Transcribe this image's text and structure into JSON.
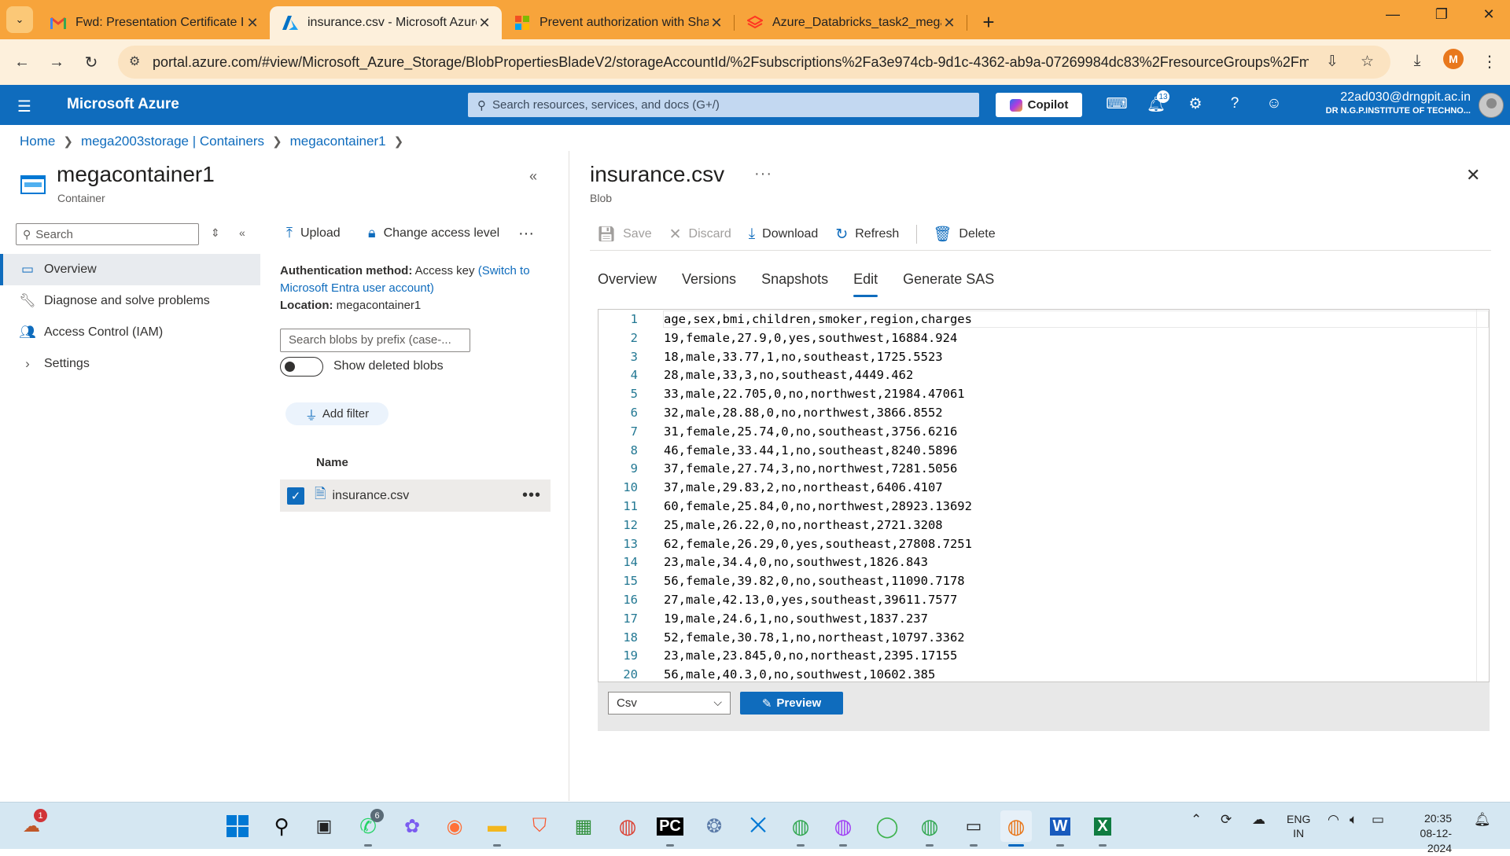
{
  "browser": {
    "tabs": [
      {
        "title": "Fwd: Presentation Certificate ID",
        "icon": "gmail-icon"
      },
      {
        "title": "insurance.csv - Microsoft Azure",
        "icon": "azure-icon",
        "active": true
      },
      {
        "title": "Prevent authorization with Shar",
        "icon": "microsoft-icon"
      },
      {
        "title": "Azure_Databricks_task2_mega -",
        "icon": "databricks-icon"
      }
    ],
    "url": "portal.azure.com/#view/Microsoft_Azure_Storage/BlobPropertiesBladeV2/storageAccountId/%2Fsubscriptions%2Fa3e974cb-9d1c-4362-ab9a-07269984dc83%2FresourceGroups%2Fmega_da...",
    "profile_initial": "M"
  },
  "azure": {
    "brand": "Microsoft Azure",
    "search_placeholder": "Search resources, services, and docs (G+/)",
    "copilot_label": "Copilot",
    "notifications_count": "13",
    "account_email": "22ad030@drngpit.ac.in",
    "account_org": "DR N.G.P.INSTITUTE OF TECHNO..."
  },
  "breadcrumb": [
    "Home",
    "mega2003storage | Containers",
    "megacontainer1"
  ],
  "container": {
    "title": "megacontainer1",
    "subtitle": "Container",
    "search_placeholder": "Search",
    "nav": [
      "Overview",
      "Diagnose and solve problems",
      "Access Control (IAM)",
      "Settings"
    ],
    "commands": {
      "upload": "Upload",
      "change_access": "Change access level"
    },
    "auth_label": "Authentication method:",
    "auth_value": "Access key",
    "auth_link": "(Switch to Microsoft Entra user account)",
    "location_label": "Location:",
    "location_value": "megacontainer1",
    "prefix_placeholder": "Search blobs by prefix (case-...",
    "show_deleted": "Show deleted blobs",
    "add_filter": "Add filter",
    "name_header": "Name",
    "blobs": [
      "insurance.csv"
    ]
  },
  "blob": {
    "title": "insurance.csv",
    "subtitle": "Blob",
    "toolbar": {
      "save": "Save",
      "discard": "Discard",
      "download": "Download",
      "refresh": "Refresh",
      "delete": "Delete"
    },
    "tabs": [
      "Overview",
      "Versions",
      "Snapshots",
      "Edit",
      "Generate SAS"
    ],
    "active_tab": "Edit",
    "lines": [
      "age,sex,bmi,children,smoker,region,charges",
      "19,female,27.9,0,yes,southwest,16884.924",
      "18,male,33.77,1,no,southeast,1725.5523",
      "28,male,33,3,no,southeast,4449.462",
      "33,male,22.705,0,no,northwest,21984.47061",
      "32,male,28.88,0,no,northwest,3866.8552",
      "31,female,25.74,0,no,southeast,3756.6216",
      "46,female,33.44,1,no,southeast,8240.5896",
      "37,female,27.74,3,no,northwest,7281.5056",
      "37,male,29.83,2,no,northeast,6406.4107",
      "60,female,25.84,0,no,northwest,28923.13692",
      "25,male,26.22,0,no,northeast,2721.3208",
      "62,female,26.29,0,yes,southeast,27808.7251",
      "23,male,34.4,0,no,southwest,1826.843",
      "56,female,39.82,0,no,southeast,11090.7178",
      "27,male,42.13,0,yes,southeast,39611.7577",
      "19,male,24.6,1,no,southwest,1837.237",
      "52,female,30.78,1,no,northeast,10797.3362",
      "23,male,23.845,0,no,northeast,2395.17155",
      "56,male,40.3,0,no,southwest,10602.385"
    ],
    "format": "Csv",
    "preview_label": "Preview"
  },
  "taskbar": {
    "badges": {
      "notify": "1",
      "whatsapp": "6"
    },
    "lang_top": "ENG",
    "lang_bottom": "IN",
    "time": "20:35",
    "date": "08-12-2024"
  }
}
